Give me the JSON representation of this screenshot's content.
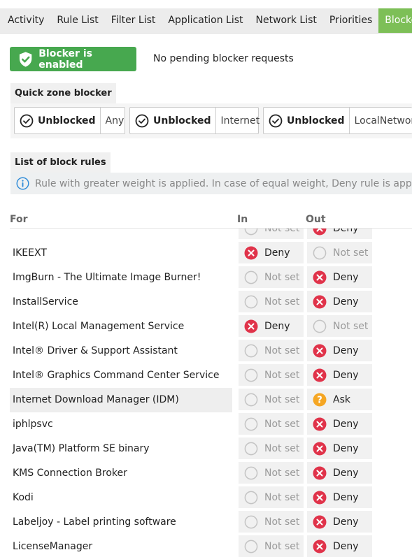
{
  "tabs": [
    {
      "label": "Activity",
      "active": false
    },
    {
      "label": "Rule List",
      "active": false
    },
    {
      "label": "Filter List",
      "active": false
    },
    {
      "label": "Application List",
      "active": false
    },
    {
      "label": "Network List",
      "active": false
    },
    {
      "label": "Priorities",
      "active": false
    },
    {
      "label": "Blocker",
      "active": true
    }
  ],
  "blocker": {
    "enabled_label": "Blocker is enabled",
    "pending_text": "No pending blocker requests"
  },
  "quick_zone": {
    "title": "Quick zone blocker",
    "zones": [
      {
        "state": "Unblocked",
        "name": "Any"
      },
      {
        "state": "Unblocked",
        "name": "Internet"
      },
      {
        "state": "Unblocked",
        "name": "LocalNetwork"
      }
    ]
  },
  "block_rules": {
    "title": "List of block rules",
    "info": "Rule with greater weight is applied. In case of equal weight, Deny rule is applied first."
  },
  "table": {
    "headers": {
      "for": "For",
      "in": "In",
      "out": "Out"
    },
    "rows": [
      {
        "name": "",
        "in": "notset",
        "in_label": "Not set",
        "out": "deny",
        "out_label": "Deny"
      },
      {
        "name": "IKEEXT",
        "in": "deny",
        "in_label": "Deny",
        "out": "notset",
        "out_label": "Not set"
      },
      {
        "name": "ImgBurn - The Ultimate Image Burner!",
        "in": "notset",
        "in_label": "Not set",
        "out": "deny",
        "out_label": "Deny"
      },
      {
        "name": "InstallService",
        "in": "notset",
        "in_label": "Not set",
        "out": "deny",
        "out_label": "Deny"
      },
      {
        "name": "Intel(R) Local Management Service",
        "in": "deny",
        "in_label": "Deny",
        "out": "notset",
        "out_label": "Not set"
      },
      {
        "name": "Intel® Driver & Support Assistant",
        "in": "notset",
        "in_label": "Not set",
        "out": "deny",
        "out_label": "Deny"
      },
      {
        "name": "Intel® Graphics Command Center Service",
        "in": "notset",
        "in_label": "Not set",
        "out": "deny",
        "out_label": "Deny"
      },
      {
        "name": "Internet Download Manager (IDM)",
        "in": "notset",
        "in_label": "Not set",
        "out": "ask",
        "out_label": "Ask",
        "highlighted": true
      },
      {
        "name": "iphlpsvc",
        "in": "notset",
        "in_label": "Not set",
        "out": "deny",
        "out_label": "Deny"
      },
      {
        "name": "Java(TM) Platform SE binary",
        "in": "notset",
        "in_label": "Not set",
        "out": "deny",
        "out_label": "Deny"
      },
      {
        "name": "KMS Connection Broker",
        "in": "notset",
        "in_label": "Not set",
        "out": "deny",
        "out_label": "Deny"
      },
      {
        "name": "Kodi",
        "in": "notset",
        "in_label": "Not set",
        "out": "deny",
        "out_label": "Deny"
      },
      {
        "name": "Labeljoy - Label printing software",
        "in": "notset",
        "in_label": "Not set",
        "out": "deny",
        "out_label": "Deny"
      },
      {
        "name": "LicenseManager",
        "in": "notset",
        "in_label": "Not set",
        "out": "deny",
        "out_label": "Deny"
      }
    ]
  },
  "colors": {
    "accent": "#7dbf57",
    "enabled": "#47a84f",
    "deny": "#e0334a",
    "ask": "#f5a623",
    "info": "#2e8bd8"
  }
}
